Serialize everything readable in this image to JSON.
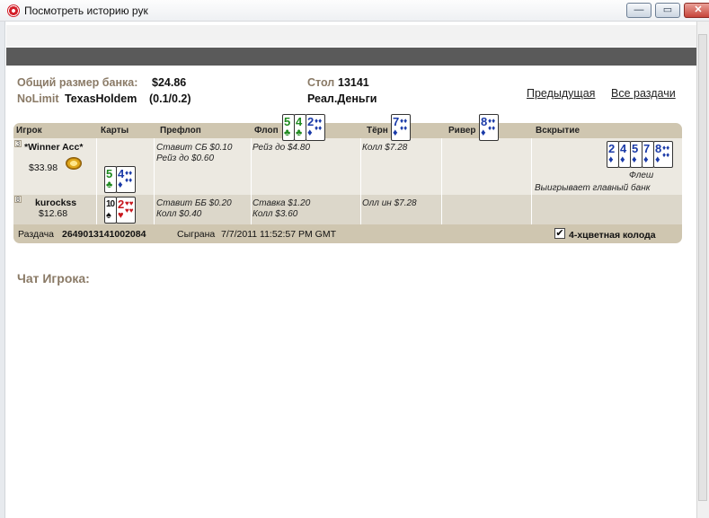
{
  "window": {
    "title": "Посмотреть историю рук",
    "minimize_glyph": "—",
    "maximize_glyph": "▭",
    "close_glyph": "✕"
  },
  "info": {
    "pot_label": "Общий размер банка:",
    "pot_value": "$24.86",
    "table_label": "Стол",
    "table_value": "13141",
    "limit_label": "NoLimit",
    "game_value": "TexasHoldem",
    "stakes_value": "(0.1/0.2)",
    "money_value": "Реал.Деньги",
    "prev_link": "Предыдущая",
    "all_link": "Все раздачи"
  },
  "columns": {
    "player": "Игрок",
    "cards": "Карты",
    "preflop": "Префлоп",
    "flop": "Флоп",
    "turn": "Тёрн",
    "river": "Ривер",
    "showdown": "Вскрытие"
  },
  "board": {
    "flop": [
      {
        "rank": "5",
        "suit": "♣",
        "color": "green"
      },
      {
        "rank": "4",
        "suit": "♣",
        "color": "green"
      },
      {
        "rank": "2",
        "suit": "♦",
        "color": "blue"
      }
    ],
    "turn": [
      {
        "rank": "7",
        "suit": "♦",
        "color": "blue"
      }
    ],
    "river": [
      {
        "rank": "8",
        "suit": "♦",
        "color": "blue"
      }
    ]
  },
  "players": [
    {
      "seat": "3",
      "name": "*Winner Acc*",
      "stack": "$33.98",
      "cards": [
        {
          "rank": "5",
          "suit": "♣",
          "color": "green"
        },
        {
          "rank": "4",
          "suit": "♦",
          "color": "blue"
        }
      ],
      "preflop": [
        "Ставит СБ $0.10",
        "Рейз до $0.60"
      ],
      "flop": [
        "Рейз до $4.80"
      ],
      "turn": [
        "Колл $7.28"
      ],
      "river": [],
      "showdown_cards": [
        {
          "rank": "2",
          "suit": "♦",
          "color": "blue"
        },
        {
          "rank": "4",
          "suit": "♦",
          "color": "blue"
        },
        {
          "rank": "5",
          "suit": "♦",
          "color": "blue"
        },
        {
          "rank": "7",
          "suit": "♦",
          "color": "blue"
        },
        {
          "rank": "8",
          "suit": "♦",
          "color": "blue"
        }
      ],
      "hand_name": "Флеш",
      "result": "Выигрывает главный банк"
    },
    {
      "seat": "8",
      "name": "kurockss",
      "stack": "$12.68",
      "cards": [
        {
          "rank": "10",
          "suit": "♠",
          "color": "black"
        },
        {
          "rank": "2",
          "suit": "♥",
          "color": "red"
        }
      ],
      "preflop": [
        "Ставит ББ $0.20",
        "Колл $0.40"
      ],
      "flop": [
        "Ставка $1.20",
        "Колл $3.60"
      ],
      "turn": [
        "Олл ин $7.28"
      ],
      "river": []
    }
  ],
  "footer": {
    "hand_label": "Раздача",
    "hand_id": "2649013141002084",
    "played_label": "Сыграна",
    "played_time": "7/7/2011 11:52:57 PM GMT",
    "four_color_checked": "✔",
    "four_color_label": "4-хцветная колода"
  },
  "chat_title": "Чат Игрока:",
  "colors": {
    "header_bg": "#cfc6b0",
    "row_light": "#ece9e1",
    "row_dark": "#dcd7ca",
    "label_brown": "#8a7a66",
    "card_blue": "#1a3aa8",
    "card_green": "#1f8a1f",
    "card_red": "#c8171d"
  }
}
